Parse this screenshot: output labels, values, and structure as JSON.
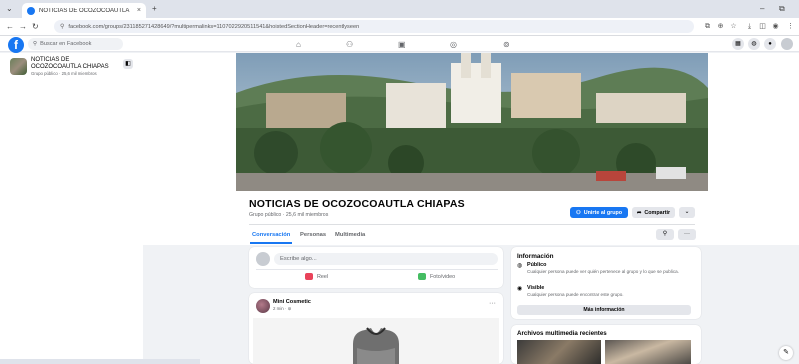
{
  "browser": {
    "tab_title": "NOTICIAS DE OCOZOCOAUTLA",
    "tab_close": "×",
    "new_tab": "+",
    "url": "facebook.com/groups/231185271428649/?multipermalinks=1107022920511541&hoistedSectionHeader=recentlyseen",
    "window_minimize": "–",
    "window_restore": "⧉"
  },
  "fb": {
    "logo": "f",
    "search_placeholder": "Buscar en Facebook"
  },
  "sidebar": {
    "group_name": "NOTICIAS DE OCOZOCOAUTLA CHIAPAS",
    "group_meta": "Grupo público · 25,6 mil miembros"
  },
  "group": {
    "title": "NOTICIAS DE OCOZOCOAUTLA CHIAPAS",
    "meta": "Grupo público · 25,6 mil miembros",
    "join_label": "Unirte al grupo",
    "share_label": "Compartir",
    "tabs": [
      {
        "label": "Conversación"
      },
      {
        "label": "Personas"
      },
      {
        "label": "Multimedia"
      }
    ]
  },
  "composer": {
    "placeholder": "Escribe algo...",
    "reel_label": "Reel",
    "photo_label": "Foto/video"
  },
  "post": {
    "author": "Mini Cosmetic",
    "time": "2 min · ⊚",
    "more": "···"
  },
  "info": {
    "heading": "Información",
    "public_title": "Público",
    "public_desc": "Cualquier persona puede ver quién pertenece al grupo y lo que se publica.",
    "visible_title": "Visible",
    "visible_desc": "Cualquier persona puede encontrar este grupo.",
    "more_button": "Más información"
  },
  "media": {
    "heading": "Archivos multimedia recientes"
  },
  "colors": {
    "fb_blue": "#1877f2",
    "page_bg": "#f0f2f5"
  }
}
